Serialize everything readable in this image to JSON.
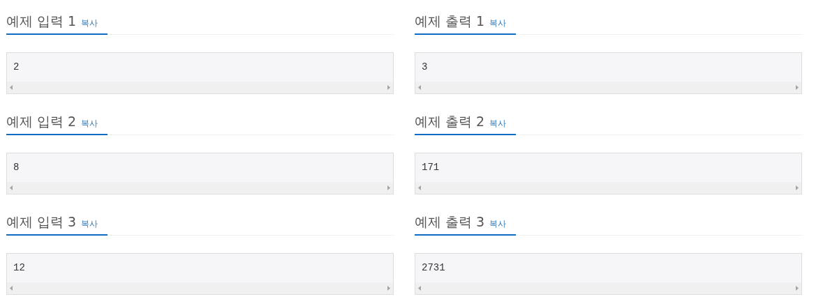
{
  "rows": [
    {
      "input": {
        "title": "예제 입력 1",
        "copy": "복사",
        "value": "2"
      },
      "output": {
        "title": "예제 출력 1",
        "copy": "복사",
        "value": "3"
      }
    },
    {
      "input": {
        "title": "예제 입력 2",
        "copy": "복사",
        "value": "8"
      },
      "output": {
        "title": "예제 출력 2",
        "copy": "복사",
        "value": "171"
      }
    },
    {
      "input": {
        "title": "예제 입력 3",
        "copy": "복사",
        "value": "12"
      },
      "output": {
        "title": "예제 출력 3",
        "copy": "복사",
        "value": "2731"
      }
    }
  ]
}
